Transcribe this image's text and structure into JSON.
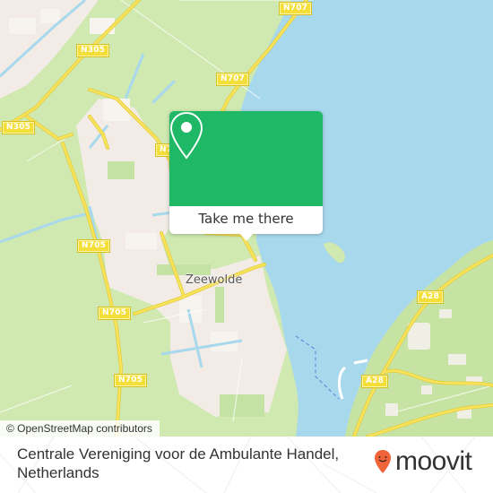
{
  "map": {
    "colors": {
      "land": "#cfe9b0",
      "water": "#a8d8ec",
      "urban": "#f2ebe6",
      "road_major": "#f6df4a",
      "accent": "#1fb867"
    },
    "road_labels": [
      {
        "id": "n707-top",
        "text": "N707"
      },
      {
        "id": "n305-upper",
        "text": "N305"
      },
      {
        "id": "n707-mid",
        "text": "N707"
      },
      {
        "id": "n305-left",
        "text": "N305"
      },
      {
        "id": "n-partial",
        "text": "N7"
      },
      {
        "id": "n705-upper",
        "text": "N705"
      },
      {
        "id": "n705-mid",
        "text": "N705"
      },
      {
        "id": "n705-lower",
        "text": "N705"
      },
      {
        "id": "a28-upper",
        "text": "A28"
      },
      {
        "id": "a28-lower",
        "text": "A28"
      }
    ],
    "place_labels": [
      {
        "id": "zeewolde",
        "text": "Zeewolde"
      }
    ],
    "attribution": "© OpenStreetMap contributors"
  },
  "popup": {
    "icon": "map-pin-icon",
    "button_label": "Take me there"
  },
  "footer": {
    "place_name_line1": "Centrale Vereniging voor de Ambulante Handel,",
    "place_name_line2": "Netherlands",
    "brand": {
      "icon": "moovit-pin-icon",
      "name": "moovit",
      "color": "#f0643a"
    }
  }
}
